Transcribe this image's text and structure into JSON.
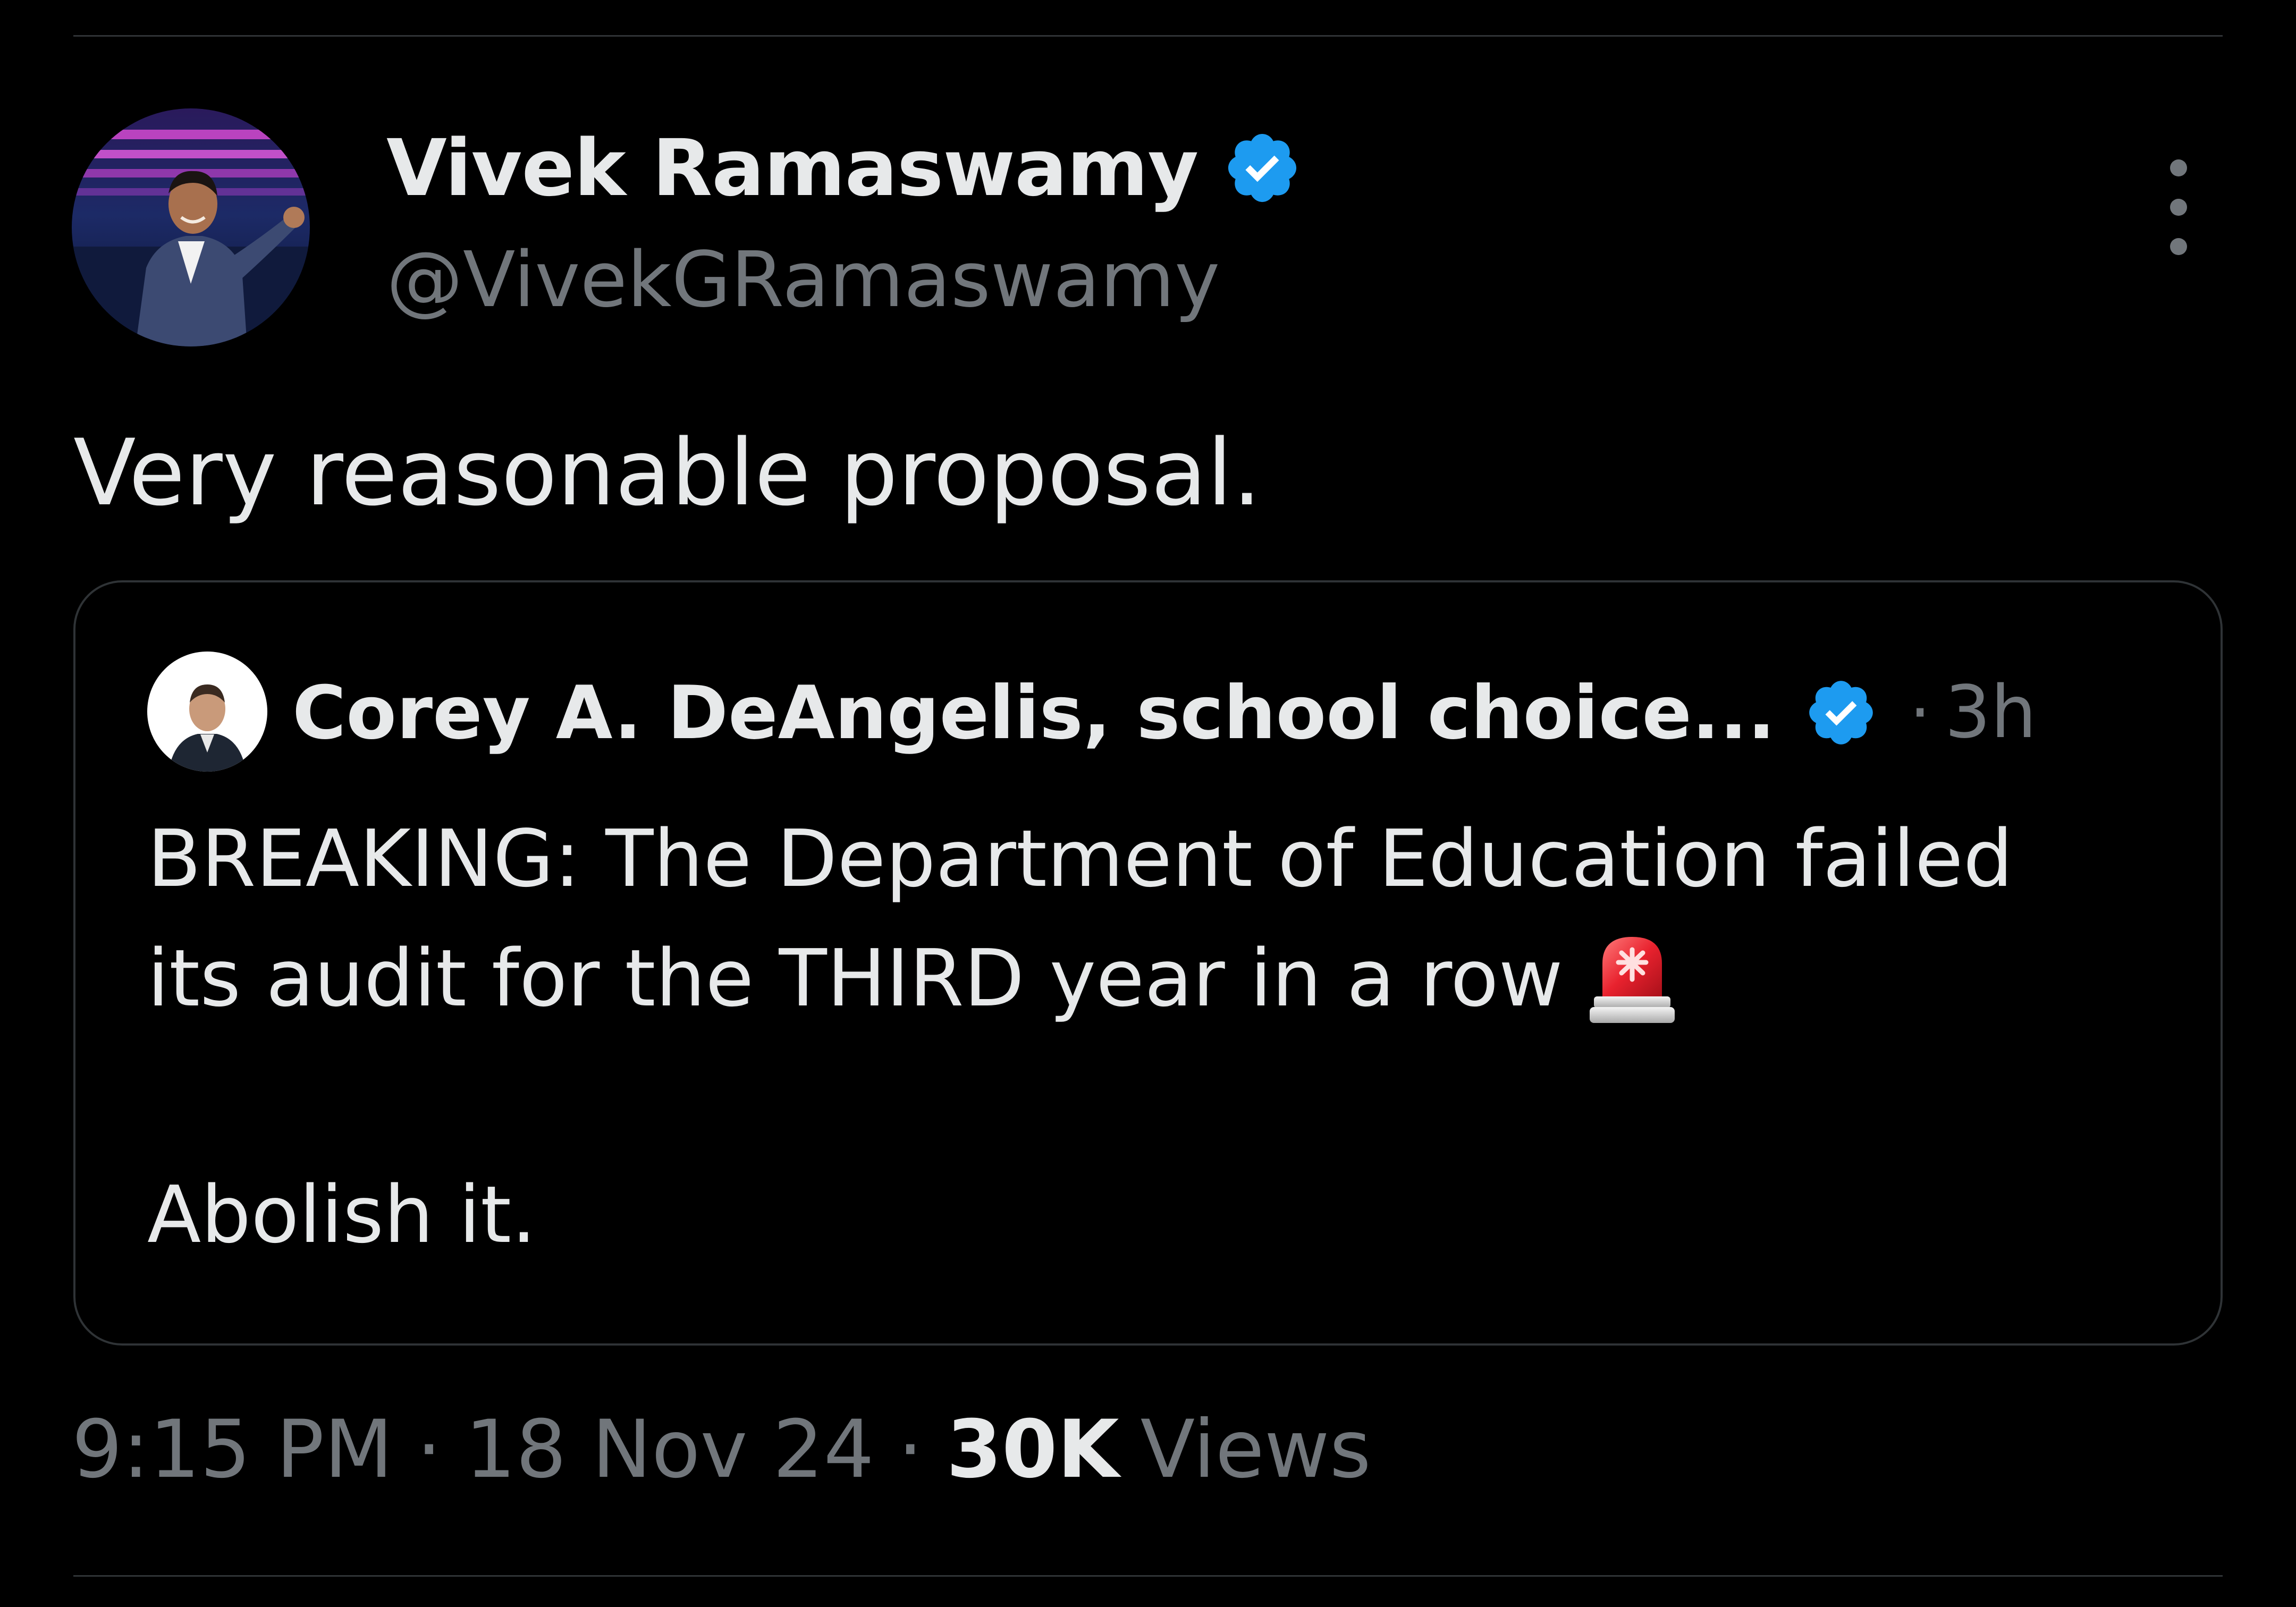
{
  "author": {
    "display_name": "Vivek Ramaswamy",
    "handle": "@VivekGRamaswamy",
    "verified": true
  },
  "tweet": {
    "text": "Very reasonable proposal."
  },
  "quoted_tweet": {
    "author_name": "Corey A. DeAngelis, school choice...",
    "verified": true,
    "separator": "·",
    "time_ago": "3h",
    "lines": [
      "BREAKING: The Department of Education failed",
      "its audit for the THIRD year in a row",
      "Abolish it."
    ],
    "emoji": "police-car-light-icon"
  },
  "meta": {
    "time": "9:15 PM",
    "separator": "·",
    "date": "18 Nov 24",
    "views_count": "30K",
    "views_label": "Views"
  },
  "colors": {
    "background": "#000000",
    "primary_text": "#e7e9ea",
    "secondary_text": "#71767b",
    "border": "#2f3336",
    "verified_blue": "#1d9bf0"
  }
}
